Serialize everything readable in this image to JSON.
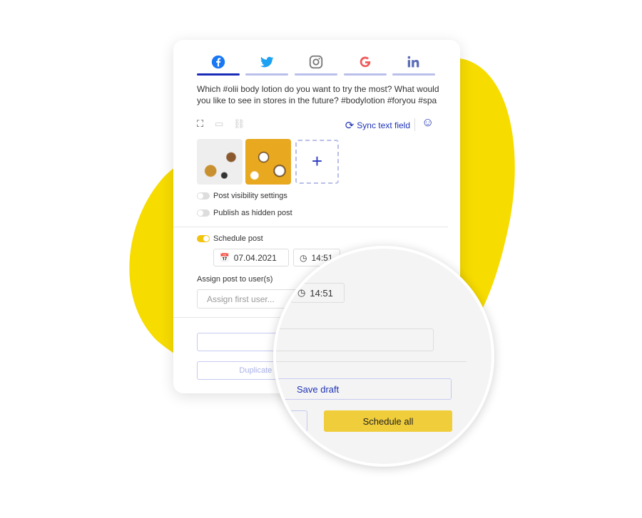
{
  "colors": {
    "accent": "#1a2bb8",
    "yellow": "#f7dc00",
    "button_yellow": "#f0cd3a"
  },
  "tabs": [
    {
      "name": "facebook",
      "icon": "facebook-icon",
      "active": true
    },
    {
      "name": "twitter",
      "icon": "twitter-icon",
      "active": false
    },
    {
      "name": "instagram",
      "icon": "instagram-icon",
      "active": false
    },
    {
      "name": "google",
      "icon": "google-icon",
      "active": false
    },
    {
      "name": "linkedin",
      "icon": "linkedin-icon",
      "active": false
    }
  ],
  "post": {
    "text": "Which #olii body lotion do you want to try the most? What would you like to see in stores in the future? #bodylotion #foryou #spa"
  },
  "toolbar": {
    "sync_label": "Sync text field"
  },
  "settings": {
    "visibility_label": "Post visibility settings",
    "visibility_on": false,
    "hidden_label": "Publish as hidden post",
    "hidden_on": false,
    "schedule_label": "Schedule post",
    "schedule_on": true,
    "date": "07.04.2021",
    "time": "14:51"
  },
  "assign": {
    "label": "Assign post to user(s)",
    "placeholder": "Assign first user..."
  },
  "buttons": {
    "duplicate": "Duplicate po",
    "save_draft": "Save draft",
    "schedule_all": "Schedule all"
  },
  "lens": {
    "time": "14:51"
  }
}
